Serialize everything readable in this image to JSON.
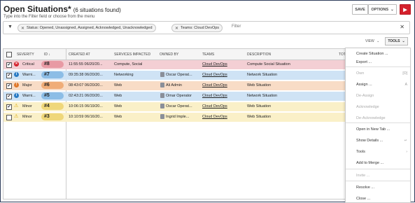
{
  "header": {
    "title": "Open Situations*",
    "count": "(6 situations found)",
    "subtitle": "Type into the Filter field or choose from the menu",
    "save_label": "SAVE",
    "options_label": "OPTIONS",
    "options_chevron": "⌄",
    "play_glyph": "▶"
  },
  "filter": {
    "funnel": "▼",
    "status_chip": "Status: Opened, Unassigned, Assigned, Acknowledged, Unacknowledged",
    "teams_chip": "Teams: Cloud DevOps",
    "chip_close": "✕",
    "placeholder": "Filter",
    "clear": "✕"
  },
  "toolbar": {
    "view_label": "VIEW",
    "view_chevron": "⌄",
    "tools_label": "TOOLS",
    "tools_chevron": "⌄"
  },
  "table": {
    "headers": {
      "severity": "SEVERITY",
      "id": "ID",
      "sort": "↓",
      "created": "CREATED AT",
      "services": "SERVICES IMPACTED",
      "owned": "OWNED BY",
      "teams": "TEAMS",
      "description": "DESCRIPTION",
      "extra": "TOT"
    },
    "rows": [
      {
        "checked": "✔",
        "severity": "Critical",
        "sev_glyph": "✕",
        "id": "#8",
        "created": "11:55:55 06/20/20...",
        "services": "Compute, Social",
        "owner": "",
        "team": "Cloud DevOps",
        "description": "Compute Social Situation"
      },
      {
        "checked": "✔",
        "severity": "Warni...",
        "sev_glyph": "i",
        "id": "#7",
        "created": "09:35:38 06/20/20...",
        "services": "Networking",
        "owner": "Oscar Operat...",
        "team": "Cloud DevOps",
        "description": "Network Situation"
      },
      {
        "checked": "✔",
        "severity": "Major",
        "sev_glyph": "!",
        "id": "#6",
        "created": "08:43:07 06/20/20...",
        "services": "Web",
        "owner": "Ali Admin",
        "team": "Cloud DevOps",
        "description": "Web Situation"
      },
      {
        "checked": "✔",
        "severity": "Warni...",
        "sev_glyph": "i",
        "id": "#5",
        "created": "02:43:21 06/20/20...",
        "services": "Web",
        "owner": "Omar Operator",
        "team": "Cloud DevOps",
        "description": "Network Situation"
      },
      {
        "checked": "✔",
        "severity": "Minor",
        "sev_glyph": "⚠",
        "id": "#4",
        "created": "10:06:15 06/19/20...",
        "services": "Web",
        "owner": "Oscar Operat...",
        "team": "Cloud DevOps",
        "description": "Web Situation"
      },
      {
        "checked": "",
        "severity": "Minor",
        "sev_glyph": "⚠",
        "id": "#3",
        "created": "10:10:59 06/16/20...",
        "services": "Web",
        "owner": "Ingrid Imple...",
        "team": "Cloud DevOps",
        "description": "Web Situation"
      }
    ]
  },
  "menu": {
    "items": [
      {
        "label": "Create Situation ...",
        "disabled": false,
        "shortcut": ""
      },
      {
        "label": "Export ...",
        "disabled": false,
        "shortcut": ""
      },
      {
        "label": "Own",
        "disabled": true,
        "shortcut": "[O]"
      },
      {
        "label": "Assign ...",
        "disabled": false,
        "shortcut": "A"
      },
      {
        "label": "De-Assign",
        "disabled": true,
        "shortcut": ""
      },
      {
        "label": "Acknowledge",
        "disabled": true,
        "shortcut": ""
      },
      {
        "label": "De-Acknowledge",
        "disabled": true,
        "shortcut": ""
      },
      {
        "label": "Open in New Tab ...",
        "disabled": false,
        "shortcut": ""
      },
      {
        "label": "Show Details ...",
        "disabled": false,
        "shortcut": "↵"
      },
      {
        "label": "Tools",
        "disabled": false,
        "shortcut": "›"
      },
      {
        "label": "Add to Merge ...",
        "disabled": false,
        "shortcut": ""
      },
      {
        "label": "Invite ...",
        "disabled": true,
        "shortcut": ""
      },
      {
        "label": "Resolve ...",
        "disabled": false,
        "shortcut": ""
      },
      {
        "label": "Close ...",
        "disabled": false,
        "shortcut": ""
      }
    ]
  },
  "colors": {
    "critical_row": "#f3cfd4",
    "critical_pill": "#e89aa4",
    "critical_icon": "#d4202c",
    "warning_row": "#cfe3f5",
    "warning_pill": "#8cbde6",
    "warning_icon": "#2a7bc4",
    "major_row": "#f8dcc6",
    "major_pill": "#f0ad78",
    "major_icon": "#e0782a",
    "minor_row": "#faf0c8",
    "minor_pill": "#efd77a",
    "minor_icon": "#d8a400"
  }
}
